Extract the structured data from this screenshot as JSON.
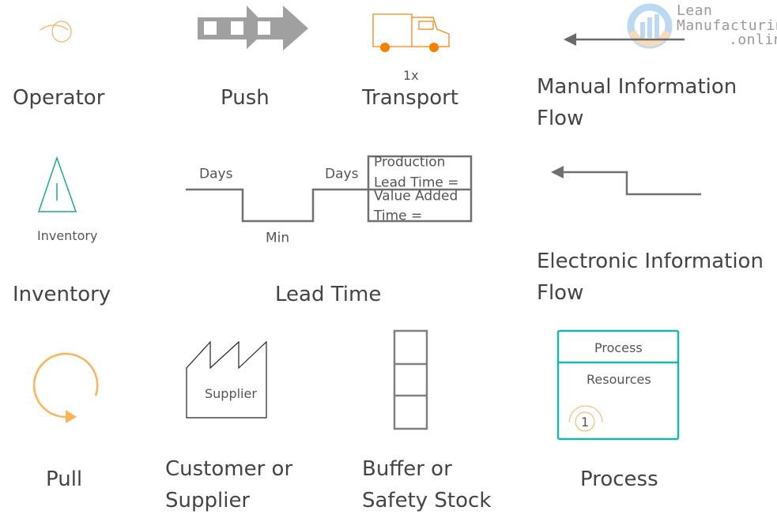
{
  "colors": {
    "operator": "#f6b25a",
    "push": "#a0a0a0",
    "transport": "#f77f00",
    "inventory": "#1aaa8f",
    "lead_time": "#707070",
    "info_flow": "#707070",
    "pull": "#fbb355",
    "supplier": "#222222",
    "buffer": "#808080",
    "process": "#16b8b0"
  },
  "watermark": {
    "line1": "Lean",
    "line2": "Manufacturing",
    "line3": ".online"
  },
  "symbols": {
    "operator": {
      "label": "Operator",
      "icon": "operator-icon"
    },
    "push": {
      "label": "Push",
      "icon": "push-arrow-icon"
    },
    "transport": {
      "label": "Transport",
      "icon": "truck-icon",
      "frequency": "1x"
    },
    "manual_flow": {
      "label_line1": "Manual Information",
      "label_line2": "Flow",
      "icon": "manual-arrow-icon"
    },
    "inventory": {
      "label": "Inventory",
      "icon": "inventory-triangle-icon",
      "icon_text": "Inventory"
    },
    "lead_time": {
      "label": "Lead Time",
      "days_1": "Days",
      "days_2": "Days",
      "min": "Min",
      "box_line1": "Production",
      "box_line2": "Lead Time =",
      "box_line3": "Value Added",
      "box_line4": "Time ="
    },
    "electronic_flow": {
      "label_line1": "Electronic Information",
      "label_line2": "Flow",
      "icon": "electronic-arrow-icon"
    },
    "pull": {
      "label": "Pull",
      "icon": "pull-circle-arrow-icon"
    },
    "supplier": {
      "label_line1": "Customer or",
      "label_line2": "Supplier",
      "icon_text": "Supplier",
      "icon": "factory-icon"
    },
    "buffer": {
      "label_line1": "Buffer or",
      "label_line2": "Safety Stock",
      "icon": "buffer-stack-icon"
    },
    "process": {
      "label": "Process",
      "box_title": "Process",
      "box_body": "Resources",
      "operator_count": "1",
      "icon": "process-box-icon"
    }
  }
}
